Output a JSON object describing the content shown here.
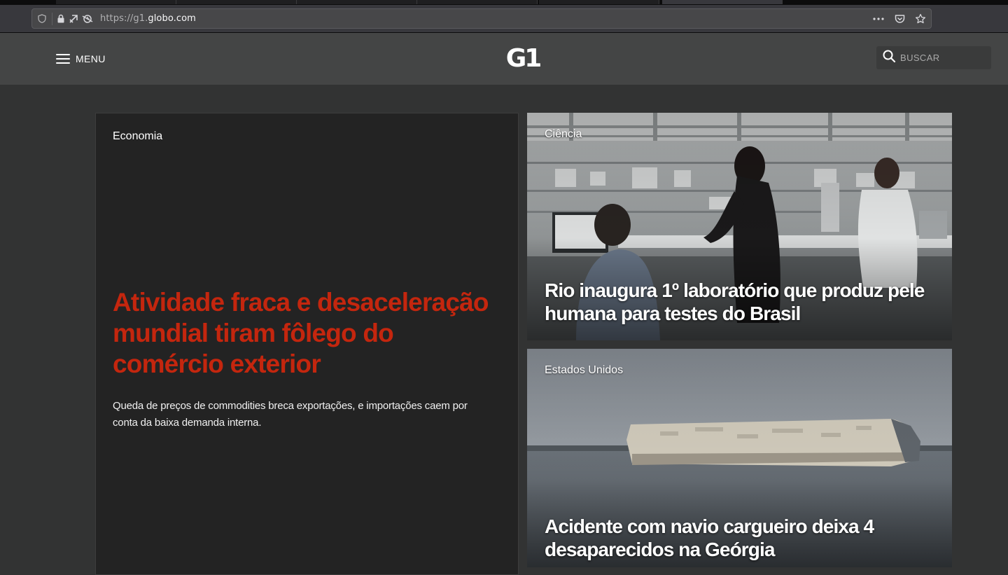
{
  "browser": {
    "url_prefix": "https://g1.",
    "url_domain": "globo.com",
    "icons": {
      "shield": "shield-icon",
      "lock": "lock-icon",
      "permissions": "permissions-icon",
      "tracking": "tracking-protection-icon",
      "page_actions": "more-actions-icon",
      "pocket": "pocket-icon",
      "bookmark": "bookmark-star-icon"
    }
  },
  "header": {
    "menu_label": "MENU",
    "logo": "G1",
    "search_placeholder": "BUSCAR"
  },
  "main_story": {
    "section": "Economia",
    "headline": "Atividade fraca e desaceleração mundial tiram fôlego do comércio exterior",
    "summary": "Queda de preços de commodities breca exportações, e importações caem por conta da baixa demanda interna."
  },
  "side_stories": [
    {
      "section": "Ciência",
      "headline": "Rio inaugura 1º laboratório que produz pele humana para testes do Brasil"
    },
    {
      "section": "Estados Unidos",
      "headline": "Acidente com navio cargueiro deixa 4 desaparecidos na Geórgia"
    }
  ],
  "colors": {
    "headline_accent": "#c4260e",
    "page_bg": "#323333",
    "header_bg": "#444545",
    "card_bg": "#232323"
  }
}
